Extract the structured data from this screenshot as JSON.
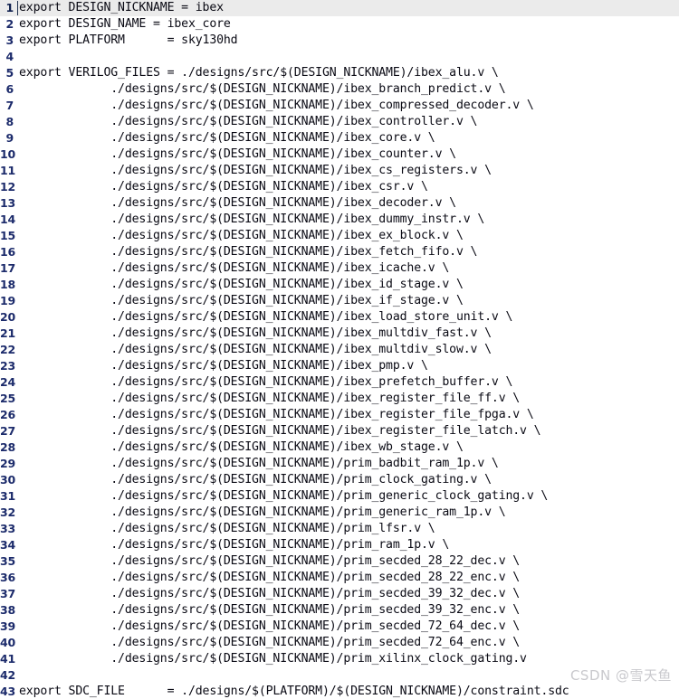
{
  "editor": {
    "language": "makefile",
    "current_line": 1,
    "total_lines": 43,
    "colors": {
      "background": "#ffffff",
      "text": "#0a0a14",
      "gutter_text": "#1c2b6b",
      "current_line_highlight": "#ebebeb",
      "caret": "#20324f",
      "watermark": "#c9c9cd"
    },
    "lines": [
      {
        "n": "1",
        "text": "export DESIGN_NICKNAME = ibex"
      },
      {
        "n": "2",
        "text": "export DESIGN_NAME = ibex_core"
      },
      {
        "n": "3",
        "text": "export PLATFORM      = sky130hd"
      },
      {
        "n": "4",
        "text": ""
      },
      {
        "n": "5",
        "text": "export VERILOG_FILES = ./designs/src/$(DESIGN_NICKNAME)/ibex_alu.v \\"
      },
      {
        "n": "6",
        "text": "             ./designs/src/$(DESIGN_NICKNAME)/ibex_branch_predict.v \\"
      },
      {
        "n": "7",
        "text": "             ./designs/src/$(DESIGN_NICKNAME)/ibex_compressed_decoder.v \\"
      },
      {
        "n": "8",
        "text": "             ./designs/src/$(DESIGN_NICKNAME)/ibex_controller.v \\"
      },
      {
        "n": "9",
        "text": "             ./designs/src/$(DESIGN_NICKNAME)/ibex_core.v \\"
      },
      {
        "n": "10",
        "text": "             ./designs/src/$(DESIGN_NICKNAME)/ibex_counter.v \\"
      },
      {
        "n": "11",
        "text": "             ./designs/src/$(DESIGN_NICKNAME)/ibex_cs_registers.v \\"
      },
      {
        "n": "12",
        "text": "             ./designs/src/$(DESIGN_NICKNAME)/ibex_csr.v \\"
      },
      {
        "n": "13",
        "text": "             ./designs/src/$(DESIGN_NICKNAME)/ibex_decoder.v \\"
      },
      {
        "n": "14",
        "text": "             ./designs/src/$(DESIGN_NICKNAME)/ibex_dummy_instr.v \\"
      },
      {
        "n": "15",
        "text": "             ./designs/src/$(DESIGN_NICKNAME)/ibex_ex_block.v \\"
      },
      {
        "n": "16",
        "text": "             ./designs/src/$(DESIGN_NICKNAME)/ibex_fetch_fifo.v \\"
      },
      {
        "n": "17",
        "text": "             ./designs/src/$(DESIGN_NICKNAME)/ibex_icache.v \\"
      },
      {
        "n": "18",
        "text": "             ./designs/src/$(DESIGN_NICKNAME)/ibex_id_stage.v \\"
      },
      {
        "n": "19",
        "text": "             ./designs/src/$(DESIGN_NICKNAME)/ibex_if_stage.v \\"
      },
      {
        "n": "20",
        "text": "             ./designs/src/$(DESIGN_NICKNAME)/ibex_load_store_unit.v \\"
      },
      {
        "n": "21",
        "text": "             ./designs/src/$(DESIGN_NICKNAME)/ibex_multdiv_fast.v \\"
      },
      {
        "n": "22",
        "text": "             ./designs/src/$(DESIGN_NICKNAME)/ibex_multdiv_slow.v \\"
      },
      {
        "n": "23",
        "text": "             ./designs/src/$(DESIGN_NICKNAME)/ibex_pmp.v \\"
      },
      {
        "n": "24",
        "text": "             ./designs/src/$(DESIGN_NICKNAME)/ibex_prefetch_buffer.v \\"
      },
      {
        "n": "25",
        "text": "             ./designs/src/$(DESIGN_NICKNAME)/ibex_register_file_ff.v \\"
      },
      {
        "n": "26",
        "text": "             ./designs/src/$(DESIGN_NICKNAME)/ibex_register_file_fpga.v \\"
      },
      {
        "n": "27",
        "text": "             ./designs/src/$(DESIGN_NICKNAME)/ibex_register_file_latch.v \\"
      },
      {
        "n": "28",
        "text": "             ./designs/src/$(DESIGN_NICKNAME)/ibex_wb_stage.v \\"
      },
      {
        "n": "29",
        "text": "             ./designs/src/$(DESIGN_NICKNAME)/prim_badbit_ram_1p.v \\"
      },
      {
        "n": "30",
        "text": "             ./designs/src/$(DESIGN_NICKNAME)/prim_clock_gating.v \\"
      },
      {
        "n": "31",
        "text": "             ./designs/src/$(DESIGN_NICKNAME)/prim_generic_clock_gating.v \\"
      },
      {
        "n": "32",
        "text": "             ./designs/src/$(DESIGN_NICKNAME)/prim_generic_ram_1p.v \\"
      },
      {
        "n": "33",
        "text": "             ./designs/src/$(DESIGN_NICKNAME)/prim_lfsr.v \\"
      },
      {
        "n": "34",
        "text": "             ./designs/src/$(DESIGN_NICKNAME)/prim_ram_1p.v \\"
      },
      {
        "n": "35",
        "text": "             ./designs/src/$(DESIGN_NICKNAME)/prim_secded_28_22_dec.v \\"
      },
      {
        "n": "36",
        "text": "             ./designs/src/$(DESIGN_NICKNAME)/prim_secded_28_22_enc.v \\"
      },
      {
        "n": "37",
        "text": "             ./designs/src/$(DESIGN_NICKNAME)/prim_secded_39_32_dec.v \\"
      },
      {
        "n": "38",
        "text": "             ./designs/src/$(DESIGN_NICKNAME)/prim_secded_39_32_enc.v \\"
      },
      {
        "n": "39",
        "text": "             ./designs/src/$(DESIGN_NICKNAME)/prim_secded_72_64_dec.v \\"
      },
      {
        "n": "40",
        "text": "             ./designs/src/$(DESIGN_NICKNAME)/prim_secded_72_64_enc.v \\"
      },
      {
        "n": "41",
        "text": "             ./designs/src/$(DESIGN_NICKNAME)/prim_xilinx_clock_gating.v"
      },
      {
        "n": "42",
        "text": ""
      },
      {
        "n": "43",
        "text": "export SDC_FILE      = ./designs/$(PLATFORM)/$(DESIGN_NICKNAME)/constraint.sdc"
      }
    ]
  },
  "watermark": {
    "text": "CSDN @雪天鱼"
  }
}
